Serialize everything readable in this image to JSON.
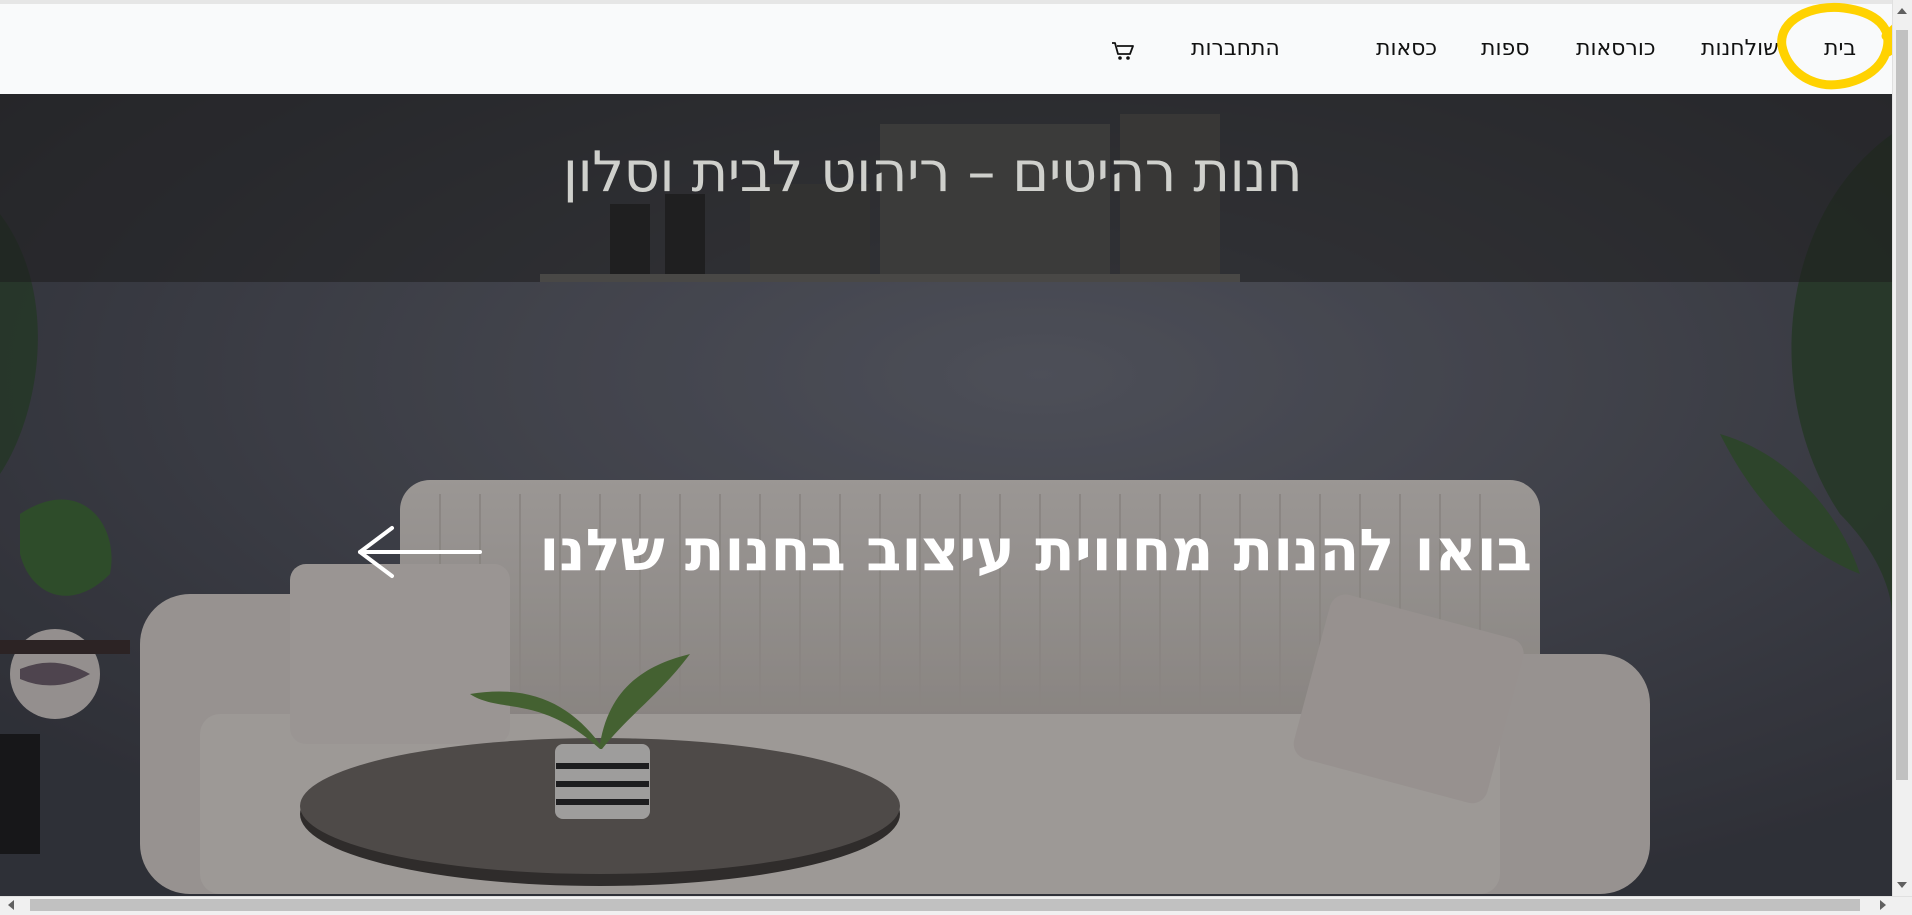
{
  "nav": {
    "home": "בית",
    "tables": "שולחנות",
    "armchairs": "כורסאות",
    "sofas": "ספות",
    "chairs": "כסאות",
    "login": "התחברות",
    "cart_icon": "cart-icon"
  },
  "hero": {
    "title": "חנות רהיטים – ריהוט לבית וסלון",
    "cta": "בואו להנות מחווית עיצוב בחנות שלנו",
    "arrow_icon": "arrow-left-icon"
  },
  "colors": {
    "navbar_bg": "#f9fafb",
    "highlight": "#ffd200",
    "title_text": "#cfd0cc",
    "cta_text": "#ffffff"
  }
}
